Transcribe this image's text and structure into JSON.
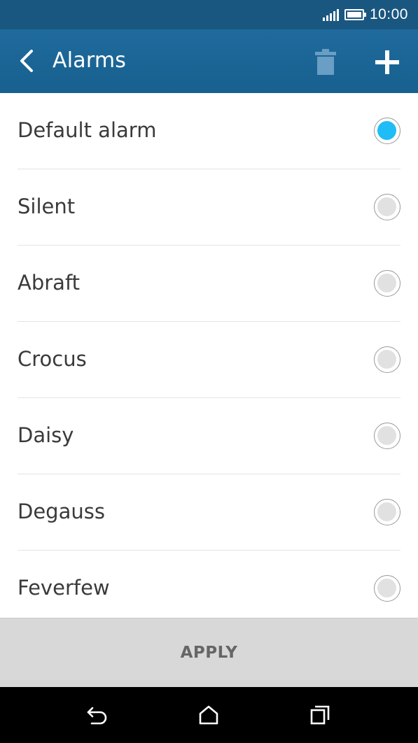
{
  "status_bar": {
    "time": "10:00",
    "icons": [
      "signal-icon",
      "battery-icon"
    ]
  },
  "app_bar": {
    "title": "Alarms",
    "icons": [
      "back-icon",
      "trash-icon",
      "plus-icon"
    ]
  },
  "alarms": [
    {
      "label": "Default alarm",
      "selected": true
    },
    {
      "label": "Silent",
      "selected": false
    },
    {
      "label": "Abraft",
      "selected": false
    },
    {
      "label": "Crocus",
      "selected": false
    },
    {
      "label": "Daisy",
      "selected": false
    },
    {
      "label": "Degauss",
      "selected": false
    },
    {
      "label": "Feverfew",
      "selected": false
    }
  ],
  "apply": {
    "label": "APPLY"
  },
  "nav_bar": {
    "icons": [
      "back-nav-icon",
      "home-icon",
      "recents-icon"
    ]
  },
  "colors": {
    "app_bar": "#1f6b9d",
    "selected_radio": "#1fbcf6",
    "apply_bar": "#d8d8d8"
  }
}
